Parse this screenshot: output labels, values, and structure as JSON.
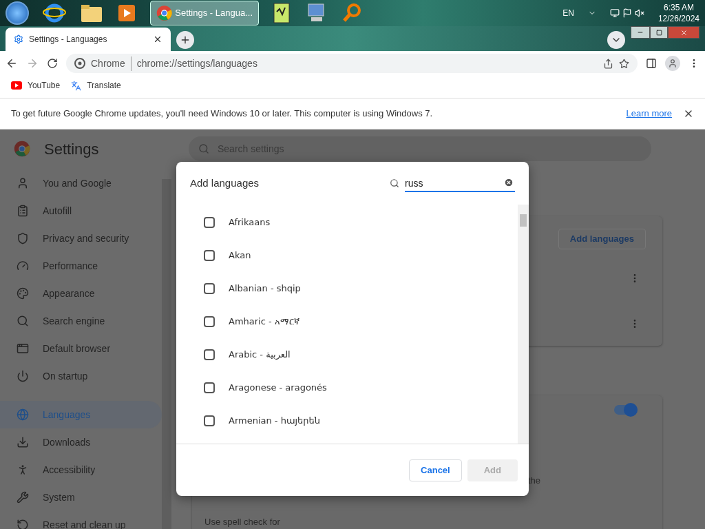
{
  "taskbar": {
    "active_app": {
      "label": "Settings - Langua..."
    },
    "language": "EN",
    "time": "6:35 AM",
    "date": "12/26/2024"
  },
  "browser": {
    "tab": {
      "title": "Settings - Languages"
    },
    "omnibox": {
      "chip": "Chrome",
      "url": "chrome://settings/languages"
    },
    "bookmarks": [
      {
        "kind": "youtube",
        "label": "YouTube"
      },
      {
        "kind": "translate",
        "label": "Translate"
      }
    ],
    "infobar": {
      "message": "To get future Google Chrome updates, you'll need Windows 10 or later. This computer is using Windows 7.",
      "link": "Learn more"
    }
  },
  "settings": {
    "title": "Settings",
    "search": {
      "placeholder": "Search settings"
    },
    "sidebar": [
      {
        "kind": "person",
        "label": "You and Google",
        "selected": false
      },
      {
        "kind": "clipboard",
        "label": "Autofill",
        "selected": false
      },
      {
        "kind": "shield",
        "label": "Privacy and security",
        "selected": false
      },
      {
        "kind": "gauge",
        "label": "Performance",
        "selected": false
      },
      {
        "kind": "palette",
        "label": "Appearance",
        "selected": false
      },
      {
        "kind": "search",
        "label": "Search engine",
        "selected": false
      },
      {
        "kind": "browser",
        "label": "Default browser",
        "selected": false
      },
      {
        "kind": "power",
        "label": "On startup",
        "selected": false
      },
      {
        "kind": "globe",
        "label": "Languages",
        "selected": true
      },
      {
        "kind": "download",
        "label": "Downloads",
        "selected": false
      },
      {
        "kind": "accessibility",
        "label": "Accessibility",
        "selected": false
      },
      {
        "kind": "wrench",
        "label": "System",
        "selected": false
      },
      {
        "kind": "reset",
        "label": "Reset and clean up",
        "selected": false
      }
    ],
    "main": {
      "add_button": "Add languages",
      "spell_toggle": {
        "on": true
      },
      "fragment": "the",
      "spell_label": "Use spell check for"
    }
  },
  "dialog": {
    "title": "Add languages",
    "search": {
      "value": "russ"
    },
    "languages": [
      {
        "label": "Afrikaans",
        "checked": false
      },
      {
        "label": "Akan",
        "checked": false
      },
      {
        "label": "Albanian - shqip",
        "checked": false
      },
      {
        "label": "Amharic - አማርኛ",
        "checked": false
      },
      {
        "label": "Arabic - العربية",
        "checked": false
      },
      {
        "label": "Aragonese - aragonés",
        "checked": false
      },
      {
        "label": "Armenian - հայերեն",
        "checked": false
      }
    ],
    "buttons": {
      "cancel": {
        "label": "Cancel"
      },
      "add": {
        "label": "Add",
        "disabled": true
      }
    }
  }
}
